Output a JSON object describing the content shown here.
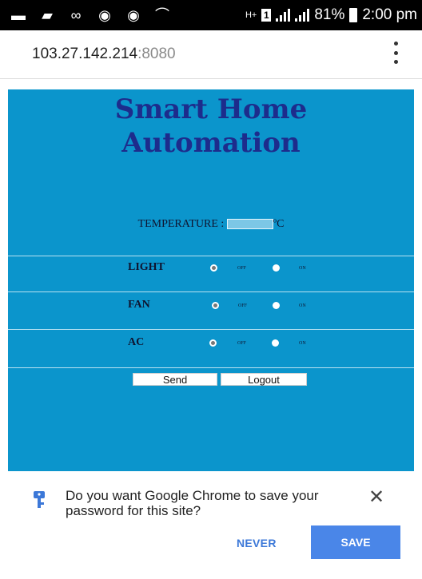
{
  "status_bar": {
    "battery": "81%",
    "time": "2:00 pm",
    "icons": [
      "message-icon",
      "image-icon",
      "link-icon",
      "chrome-icon",
      "chrome-icon",
      "missed-call-icon",
      "hplus-data-icon",
      "sim-1-icon",
      "signal-icon",
      "signal-icon",
      "battery-icon"
    ]
  },
  "browser": {
    "url_host": "103.27.142.214",
    "url_port": ":8080"
  },
  "page": {
    "title_line1": "Smart Home",
    "title_line2": "Automation",
    "temperature_label": "TEMPERATURE :",
    "temperature_unit": "ºC",
    "rows": [
      {
        "label": "LIGHT",
        "off": "OFF",
        "on": "ON",
        "state": "off"
      },
      {
        "label": "FAN",
        "off": "OFF",
        "on": "ON",
        "state": "off"
      },
      {
        "label": "AC",
        "off": "OFF",
        "on": "ON",
        "state": "off"
      }
    ],
    "send_label": "Send",
    "logout_label": "Logout",
    "background_color": "#0b95cc",
    "title_color": "#1d2c8c"
  },
  "save_prompt": {
    "message": "Do you want Google Chrome to save your password for this site?",
    "never_label": "NEVER",
    "save_label": "SAVE",
    "accent_color": "#4a86e8"
  }
}
